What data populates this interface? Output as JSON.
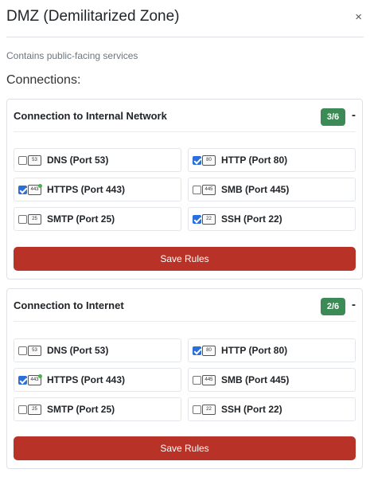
{
  "dialog": {
    "title": "DMZ (Demilitarized Zone)",
    "close_symbol": "×",
    "description": "Contains public-facing services",
    "connections_heading": "Connections:"
  },
  "colors": {
    "badge": "#3c8a55",
    "save_button": "#b83227",
    "checkbox": "#2a6fdb"
  },
  "cards": [
    {
      "title": "Connection to Internal Network",
      "count": "3/6",
      "collapse_symbol": "-",
      "save_label": "Save Rules",
      "ports": [
        {
          "label": "DNS (Port 53)",
          "icon_text": "53",
          "checked": false,
          "icon": "port-53-icon"
        },
        {
          "label": "HTTP (Port 80)",
          "icon_text": "80",
          "checked": true,
          "icon": "port-80-icon"
        },
        {
          "label": "HTTPS (Port 443)",
          "icon_text": "443",
          "checked": true,
          "icon": "port-443-secure-icon"
        },
        {
          "label": "SMB (Port 445)",
          "icon_text": "445",
          "checked": false,
          "icon": "port-445-icon"
        },
        {
          "label": "SMTP (Port 25)",
          "icon_text": "25",
          "checked": false,
          "icon": "port-25-icon"
        },
        {
          "label": "SSH (Port 22)",
          "icon_text": "22",
          "checked": true,
          "icon": "port-22-icon"
        }
      ]
    },
    {
      "title": "Connection to Internet",
      "count": "2/6",
      "collapse_symbol": "-",
      "save_label": "Save Rules",
      "ports": [
        {
          "label": "DNS (Port 53)",
          "icon_text": "53",
          "checked": false,
          "icon": "port-53-icon"
        },
        {
          "label": "HTTP (Port 80)",
          "icon_text": "80",
          "checked": true,
          "icon": "port-80-icon"
        },
        {
          "label": "HTTPS (Port 443)",
          "icon_text": "443",
          "checked": true,
          "icon": "port-443-secure-icon"
        },
        {
          "label": "SMB (Port 445)",
          "icon_text": "445",
          "checked": false,
          "icon": "port-445-icon"
        },
        {
          "label": "SMTP (Port 25)",
          "icon_text": "25",
          "checked": false,
          "icon": "port-25-icon"
        },
        {
          "label": "SSH (Port 22)",
          "icon_text": "22",
          "checked": false,
          "icon": "port-22-icon"
        }
      ]
    }
  ]
}
